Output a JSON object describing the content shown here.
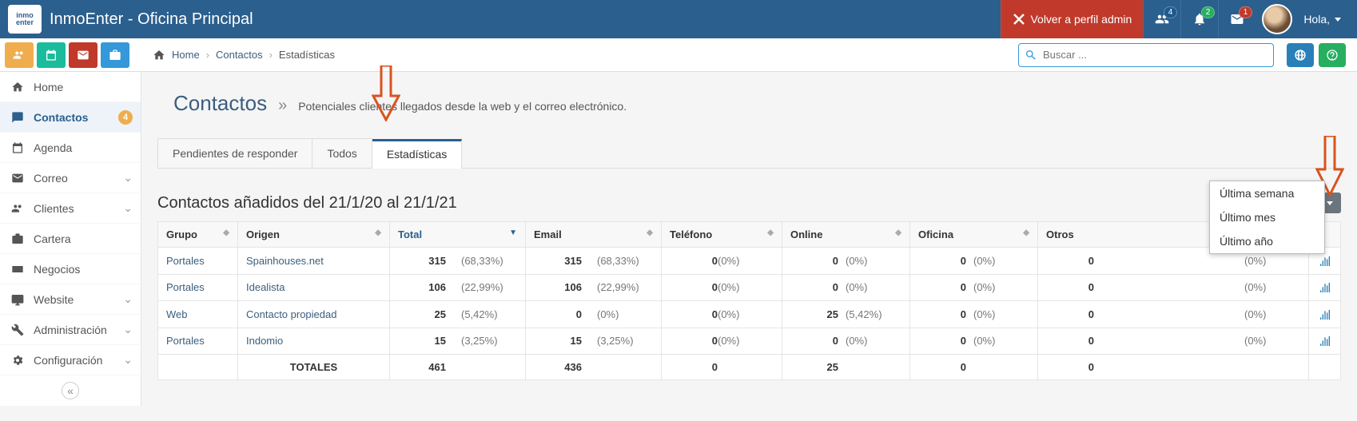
{
  "topbar": {
    "app_title": "InmoEnter - Oficina Principal",
    "back_admin": "Volver a perfil admin",
    "badge_users": "4",
    "badge_bell": "2",
    "badge_mail": "1",
    "hello": "Hola,"
  },
  "breadcrumb": {
    "home": "Home",
    "contacts": "Contactos",
    "stats": "Estadísticas"
  },
  "search": {
    "placeholder": "Buscar ..."
  },
  "sidebar": {
    "items": [
      {
        "label": "Home"
      },
      {
        "label": "Contactos"
      },
      {
        "label": "Agenda"
      },
      {
        "label": "Correo"
      },
      {
        "label": "Clientes"
      },
      {
        "label": "Cartera"
      },
      {
        "label": "Negocios"
      },
      {
        "label": "Website"
      },
      {
        "label": "Administración"
      },
      {
        "label": "Configuración"
      }
    ],
    "contacts_badge": "4"
  },
  "page": {
    "title": "Contactos",
    "subtitle": "Potenciales clientes llegados desde la web y el correo electrónico."
  },
  "tabs": {
    "pending": "Pendientes de responder",
    "all": "Todos",
    "stats": "Estadísticas"
  },
  "stats": {
    "heading": "Contactos añadidos del 21/1/20 al 21/1/21",
    "period_btn": "Último año",
    "dd": [
      "Última semana",
      "Último mes",
      "Último año"
    ]
  },
  "table": {
    "headers": {
      "grupo": "Grupo",
      "origen": "Origen",
      "total": "Total",
      "email": "Email",
      "telefono": "Teléfono",
      "online": "Online",
      "oficina": "Oficina",
      "otros": "Otros"
    },
    "rows": [
      {
        "grupo": "Portales",
        "origen": "Spainhouses.net",
        "total": {
          "n": "315",
          "p": "(68,33%)"
        },
        "email": {
          "n": "315",
          "p": "(68,33%)"
        },
        "telefono": {
          "n": "0",
          "p": "(0%)"
        },
        "online": {
          "n": "0",
          "p": "(0%)"
        },
        "oficina": {
          "n": "0",
          "p": "(0%)"
        },
        "otros": {
          "n": "0",
          "p": "(0%)"
        }
      },
      {
        "grupo": "Portales",
        "origen": "Idealista",
        "total": {
          "n": "106",
          "p": "(22,99%)"
        },
        "email": {
          "n": "106",
          "p": "(22,99%)"
        },
        "telefono": {
          "n": "0",
          "p": "(0%)"
        },
        "online": {
          "n": "0",
          "p": "(0%)"
        },
        "oficina": {
          "n": "0",
          "p": "(0%)"
        },
        "otros": {
          "n": "0",
          "p": "(0%)"
        }
      },
      {
        "grupo": "Web",
        "origen": "Contacto propiedad",
        "total": {
          "n": "25",
          "p": "(5,42%)"
        },
        "email": {
          "n": "0",
          "p": "(0%)"
        },
        "telefono": {
          "n": "0",
          "p": "(0%)"
        },
        "online": {
          "n": "25",
          "p": "(5,42%)"
        },
        "oficina": {
          "n": "0",
          "p": "(0%)"
        },
        "otros": {
          "n": "0",
          "p": "(0%)"
        }
      },
      {
        "grupo": "Portales",
        "origen": "Indomio",
        "total": {
          "n": "15",
          "p": "(3,25%)"
        },
        "email": {
          "n": "15",
          "p": "(3,25%)"
        },
        "telefono": {
          "n": "0",
          "p": "(0%)"
        },
        "online": {
          "n": "0",
          "p": "(0%)"
        },
        "oficina": {
          "n": "0",
          "p": "(0%)"
        },
        "otros": {
          "n": "0",
          "p": "(0%)"
        }
      }
    ],
    "totals": {
      "label": "TOTALES",
      "total": "461",
      "email": "436",
      "telefono": "0",
      "online": "25",
      "oficina": "0",
      "otros": "0"
    }
  }
}
